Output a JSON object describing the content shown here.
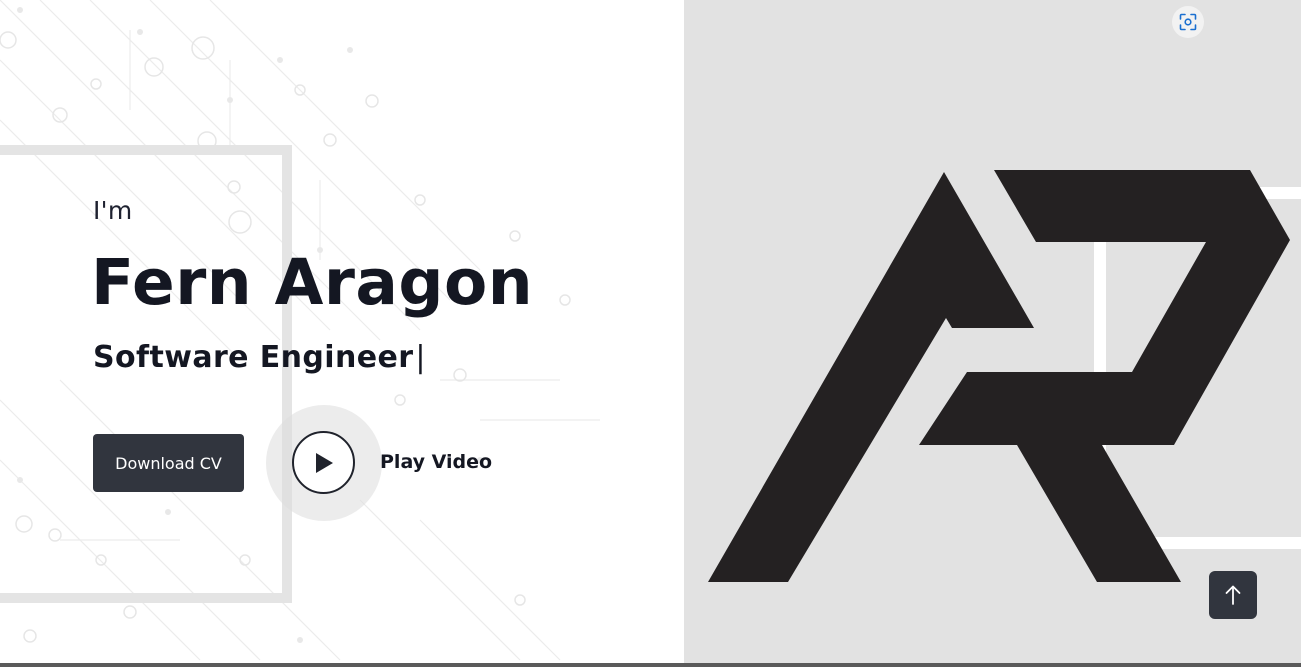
{
  "hero": {
    "intro": "I'm",
    "name": "Fern Aragon",
    "role": "Software Engineer",
    "cursor": "|",
    "download_label": "Download CV",
    "play_label": "Play Video"
  },
  "icons": {
    "play": "play-icon",
    "screenshot": "screenshot-icon",
    "arrow_up": "arrow-up-icon"
  },
  "colors": {
    "dark_button": "#31353e",
    "text_dark": "#141722",
    "right_panel_bg": "#e2e2e2",
    "logo": "#242122",
    "accent_blue": "#1a6fd0"
  }
}
